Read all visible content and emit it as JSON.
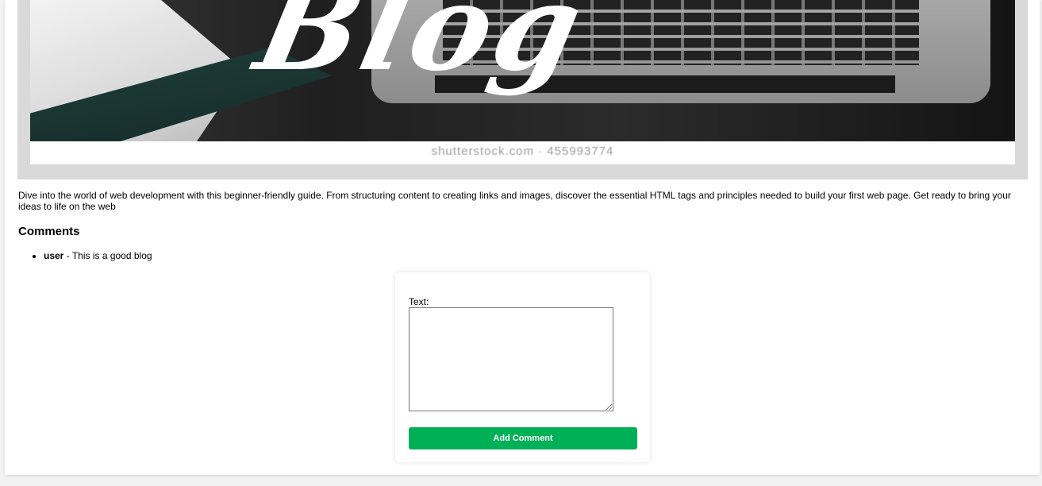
{
  "post": {
    "image": {
      "script_text": "Blog",
      "watermark": "shutterstock.com · 455993774"
    },
    "description": "Dive into the world of web development with this beginner-friendly guide. From structuring content to creating links and images, discover the essential HTML tags and principles needed to build your first web page. Get ready to bring your ideas to life on the web"
  },
  "comments": {
    "title": "Comments",
    "items": [
      {
        "user": "user",
        "separator": " - ",
        "text": "This is a good blog"
      }
    ]
  },
  "comment_form": {
    "text_label": "Text:",
    "text_value": "",
    "submit_label": "Add Comment"
  },
  "colors": {
    "page_background": "#f2f2f2",
    "image_frame": "#d9d9d9",
    "submit_button": "#00b056"
  }
}
